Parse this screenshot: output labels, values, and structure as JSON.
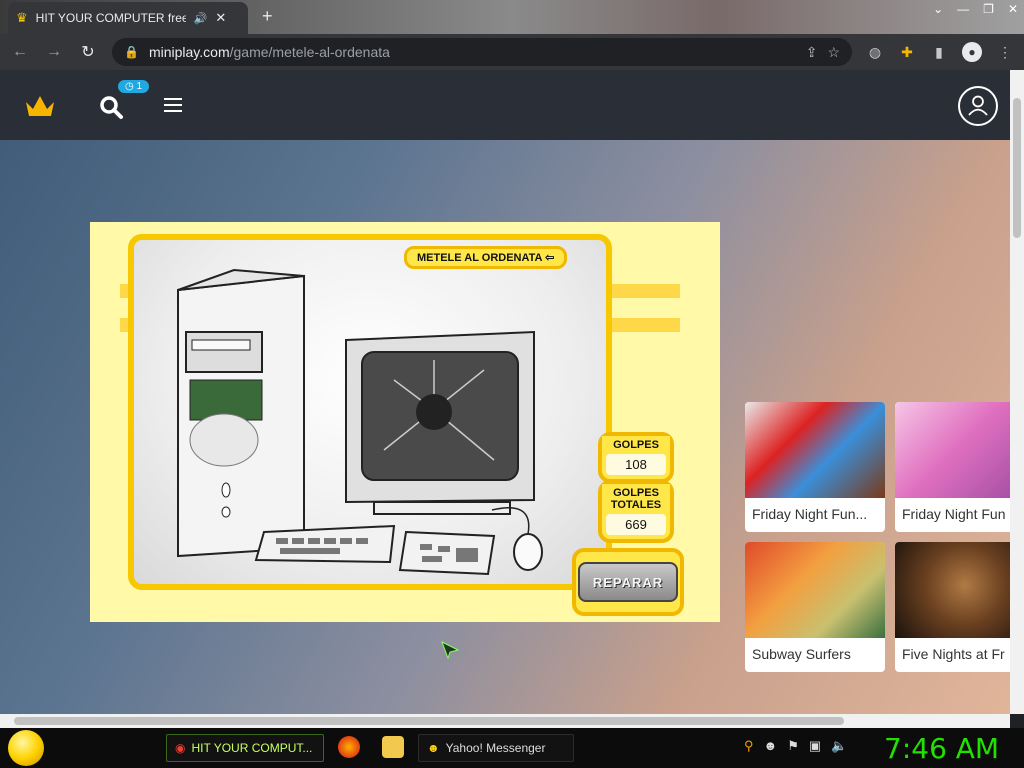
{
  "browser": {
    "tab_title": "HIT YOUR COMPUTER free c",
    "url_host": "miniplay.com",
    "url_path": "/game/metele-al-ordenata"
  },
  "site": {
    "notification_count": "1"
  },
  "game": {
    "title": "METELE AL ORDENATA",
    "hits_label": "GOLPES",
    "hits_value": "108",
    "total_hits_label": "GOLPES TOTALES",
    "total_hits_value": "669",
    "repair_label": "REPARAR"
  },
  "related_games": [
    {
      "title": "Friday Night Fun..."
    },
    {
      "title": "Friday Night Fun"
    },
    {
      "title": "Subway Surfers"
    },
    {
      "title": "Five Nights at Fr"
    }
  ],
  "taskbar": {
    "items": [
      {
        "label": "HIT YOUR COMPUT..."
      },
      {
        "label": "Yahoo! Messenger"
      }
    ],
    "clock": "7:46 AM"
  }
}
